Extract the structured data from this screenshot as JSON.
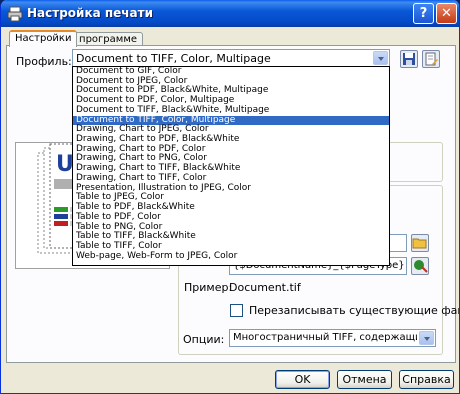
{
  "window": {
    "title": "Настройка печати"
  },
  "tabs": [
    {
      "label": "Настройки",
      "active": true
    },
    {
      "label": "О программе",
      "active": false
    }
  ],
  "profile": {
    "label": "Профиль:",
    "value": "Document to TIFF, Color, Multipage",
    "options": [
      "Document to GIF, Color",
      "Document to JPEG, Color",
      "Document to PDF, Black&White, Multipage",
      "Document to PDF, Color, Multipage",
      "Document to TIFF, Black&White, Multipage",
      "Document to TIFF, Color, Multipage",
      "Drawing, Chart to JPEG, Color",
      "Drawing, Chart to PDF, Black&White",
      "Drawing, Chart to PDF, Color",
      "Drawing, Chart to PNG, Color",
      "Drawing, Chart to TIFF, Black&White",
      "Drawing, Chart to TIFF, Color",
      "Presentation, Illustration to JPEG, Color",
      "Table to JPEG, Color",
      "Table to PDF, Black&White",
      "Table to PDF, Color",
      "Table to PNG, Color",
      "Table to TIFF, Black&White",
      "Table to TIFF, Color",
      "Web-page, Web-Form to JPEG, Color"
    ],
    "selected_index": 5
  },
  "filename_field": {
    "value": "{$DocumentName}_{$PageType}"
  },
  "example": {
    "label": "Пример:",
    "value": "Document.tif"
  },
  "overwrite": {
    "label": "Перезаписывать существующие файлы",
    "checked": false
  },
  "options_field": {
    "label": "Опции:",
    "value": "Многостраничный TIFF, содержащий все страни"
  },
  "buttons": {
    "ok": "OK",
    "cancel": "Отмена",
    "help": "Справка"
  },
  "preview": {
    "letter": "U"
  },
  "colors": {
    "title_bar": "#0a58d6",
    "selection": "#316ac5",
    "face": "#ece9d8"
  }
}
